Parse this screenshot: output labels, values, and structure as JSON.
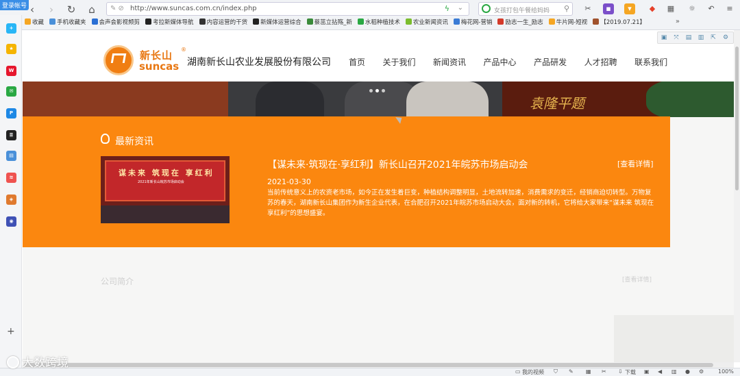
{
  "browser": {
    "login_tag": "登录帐号",
    "back": "‹",
    "forward": "›",
    "reload": "↻",
    "home": "⌂",
    "url": "http://www.suncas.com.cn/index.php",
    "search_placeholder": "女孩打包午餐给妈妈",
    "bookmarks": [
      {
        "label": "收藏",
        "color": "#f5a623"
      },
      {
        "label": "手机收藏夹",
        "color": "#4a90d9"
      },
      {
        "label": "会声会影视频剪",
        "color": "#2a6fd4"
      },
      {
        "label": "考拉新媒体导航",
        "color": "#222"
      },
      {
        "label": "内容运营的干货",
        "color": "#333"
      },
      {
        "label": "新媒体运营综合",
        "color": "#222"
      },
      {
        "label": "蔡茁立拈殇_新",
        "color": "#3a8a3a"
      },
      {
        "label": "水稻种植技术",
        "color": "#2aa843"
      },
      {
        "label": "农业新闻资讯",
        "color": "#7bbd2e"
      },
      {
        "label": "梅花网-营销",
        "color": "#3a7bd5"
      },
      {
        "label": "励志一生_励志",
        "color": "#d43a2a"
      },
      {
        "label": "牛片网-短视",
        "color": "#f5a623"
      },
      {
        "label": "【2019.07.21】",
        "color": "#a0522d"
      }
    ],
    "bookmarks_more": "»"
  },
  "site": {
    "logo_cn": "新长山",
    "logo_en": "suncas",
    "logo_reg": "®",
    "company": "湖南新长山农业发展股份有限公司",
    "menu": [
      "首页",
      "关于我们",
      "新闻资讯",
      "产品中心",
      "产品研发",
      "人才招聘",
      "联系我们"
    ]
  },
  "banner": {
    "calligraphy": "袁隆平题"
  },
  "news": {
    "section_title": "最新资讯",
    "thumb_heading": "谋未来 筑现在 享红利",
    "thumb_sub": "2021年新长山皖苏市场启动会",
    "headline": "【谋未来·筑现在·享红利】新长山召开2021年皖苏市场启动会",
    "more": "[查看详情]",
    "date": "2021-03-30",
    "body": "当前传统意义上的农资老市场，如今正在发生着巨变，种植结构调整明显，土地流转加速，消费需求的变迁，经销商迫切转型。万物复苏的春天，湖南新长山集团作为新生企业代表，在合肥召开2021年皖苏市场启动大会，面对新的转机，它将给大家带来“谋未来 筑现在 享红利”的思想盛宴。"
  },
  "about": {
    "title": "公司简介",
    "more": "[查看详情]"
  },
  "status": {
    "items": [
      "我的视频",
      "下载",
      "100%"
    ]
  },
  "watermark": "大数跨境"
}
